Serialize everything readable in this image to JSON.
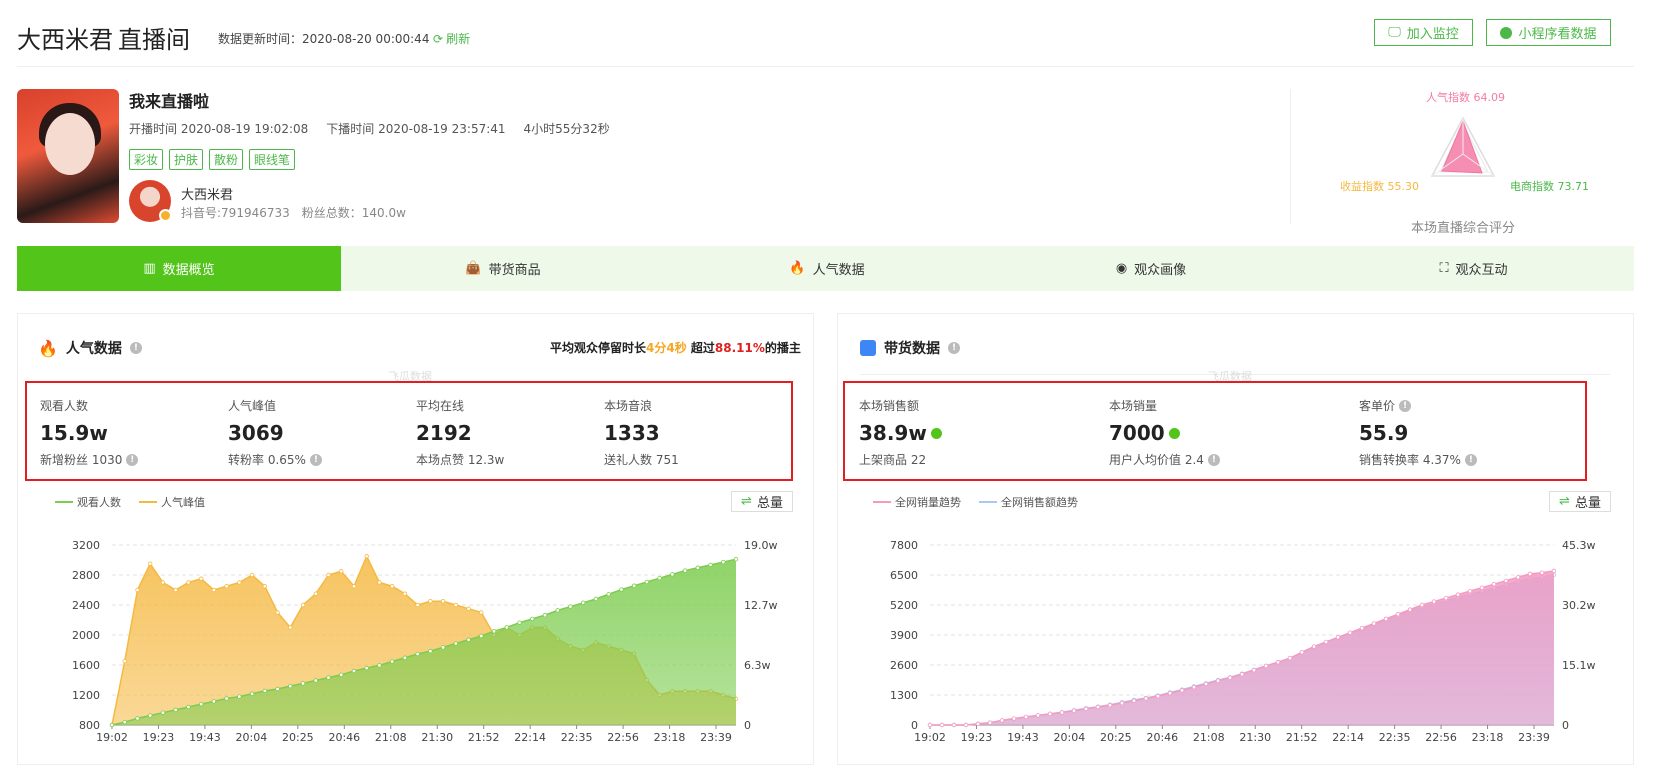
{
  "header": {
    "title": "大西米君",
    "subtitle": "直播间",
    "update_label": "数据更新时间：2020-08-20 00:00:44",
    "refresh_label": "刷新",
    "btn_monitor": "加入监控",
    "btn_mini": "小程序看数据"
  },
  "live": {
    "title": "我来直播啦",
    "start": "开播时间 2020-08-19 19:02:08",
    "end": "下播时间 2020-08-19 23:57:41",
    "duration": "4小时55分32秒",
    "tags": [
      "彩妆",
      "护肤",
      "散粉",
      "眼线笔"
    ],
    "anchor_name": "大西米君",
    "douyin_id": "抖音号:791946733",
    "fans": "粉丝总数：140.0w"
  },
  "score": {
    "popularity": "人气指数 64.09",
    "income": "收益指数 55.30",
    "ecommerce": "电商指数 73.71",
    "caption": "本场直播综合评分"
  },
  "tabs": [
    {
      "label": "数据概览",
      "icon": "bar-chart-icon"
    },
    {
      "label": "带货商品",
      "icon": "shopping-bag-icon"
    },
    {
      "label": "人气数据",
      "icon": "fire-icon"
    },
    {
      "label": "观众画像",
      "icon": "pulse-icon"
    },
    {
      "label": "观众互动",
      "icon": "focus-icon"
    }
  ],
  "popularity_panel": {
    "title": "人气数据",
    "stay_prefix": "平均观众停留时长",
    "stay_value": "4分4秒",
    "stay_mid": "超过",
    "stay_pct": "88.11%",
    "stay_suffix": "的播主",
    "watermark": "飞瓜数据",
    "metrics": [
      {
        "label": "观看人数",
        "value": "15.9w",
        "sub": "新增粉丝 1030"
      },
      {
        "label": "人气峰值",
        "value": "3069",
        "sub": "转粉率 0.65%"
      },
      {
        "label": "平均在线",
        "value": "2192",
        "sub": "本场点赞 12.3w"
      },
      {
        "label": "本场音浪",
        "value": "1333",
        "sub": "送礼人数 751"
      }
    ],
    "legend": [
      "观看人数",
      "人气峰值"
    ],
    "total_label": "总量"
  },
  "sales_panel": {
    "title": "带货数据",
    "watermark": "飞瓜数据",
    "metrics": [
      {
        "label": "本场销售额",
        "value": "38.9w",
        "sub": "上架商品 22"
      },
      {
        "label": "本场销量",
        "value": "7000",
        "sub": "用户人均价值 2.4"
      },
      {
        "label": "客单价",
        "value": "55.9",
        "sub": "销售转换率 4.37%"
      }
    ],
    "legend": [
      "全网销量趋势",
      "全网销售额趋势"
    ],
    "total_label": "总量"
  },
  "chart_data": [
    {
      "type": "area",
      "x": [
        "19:02",
        "19:23",
        "19:43",
        "20:04",
        "20:25",
        "20:46",
        "21:08",
        "21:30",
        "21:52",
        "22:14",
        "22:35",
        "22:56",
        "23:18",
        "23:39"
      ],
      "ylim_left": [
        800,
        3200
      ],
      "yticks_left": [
        "800",
        "1200",
        "1600",
        "2000",
        "2400",
        "2800",
        "3200"
      ],
      "yticks_right": [
        "0",
        "6.3w",
        "12.7w",
        "19.0w"
      ],
      "series": [
        {
          "name": "人气峰值",
          "axis": "left",
          "color": "#f5b942",
          "values": [
            800,
            1650,
            2600,
            2950,
            2700,
            2600,
            2700,
            2750,
            2600,
            2650,
            2700,
            2800,
            2650,
            2300,
            2100,
            2400,
            2550,
            2800,
            2850,
            2650,
            3050,
            2700,
            2650,
            2550,
            2400,
            2450,
            2450,
            2400,
            2350,
            2300,
            2000,
            2100,
            2000,
            2100,
            2100,
            1950,
            1850,
            1800,
            1900,
            1850,
            1800,
            1750,
            1400,
            1200,
            1250,
            1250,
            1250,
            1250,
            1200,
            1150
          ]
        },
        {
          "name": "观看人数",
          "axis": "right",
          "color": "#7ccc4e",
          "values": [
            0,
            0.3,
            0.7,
            1.0,
            1.3,
            1.6,
            1.9,
            2.2,
            2.5,
            2.8,
            3.0,
            3.3,
            3.6,
            3.8,
            4.1,
            4.4,
            4.7,
            5.0,
            5.3,
            5.7,
            6.0,
            6.3,
            6.7,
            7.1,
            7.5,
            7.8,
            8.2,
            8.6,
            9.0,
            9.4,
            9.9,
            10.3,
            10.8,
            11.2,
            11.6,
            12.1,
            12.5,
            12.9,
            13.3,
            13.8,
            14.3,
            14.7,
            15.1,
            15.5,
            15.9,
            16.3,
            16.6,
            16.9,
            17.2,
            17.5
          ]
        }
      ]
    },
    {
      "type": "area",
      "x": [
        "19:02",
        "19:23",
        "19:43",
        "20:04",
        "20:25",
        "20:46",
        "21:08",
        "21:30",
        "21:52",
        "22:14",
        "22:35",
        "22:56",
        "23:18",
        "23:39"
      ],
      "ylim_left": [
        0,
        7800
      ],
      "yticks_left": [
        "0",
        "1300",
        "2600",
        "3900",
        "5200",
        "6500",
        "7800"
      ],
      "yticks_right": [
        "0",
        "15.1w",
        "30.2w",
        "45.3w"
      ],
      "series": [
        {
          "name": "全网销量趋势",
          "axis": "left",
          "color": "#f49ac1",
          "values": [
            0,
            0,
            0,
            0,
            50,
            100,
            200,
            280,
            350,
            420,
            480,
            540,
            620,
            700,
            780,
            860,
            950,
            1050,
            1150,
            1250,
            1380,
            1500,
            1640,
            1780,
            1920,
            2050,
            2200,
            2380,
            2560,
            2720,
            2900,
            3150,
            3400,
            3600,
            3800,
            4000,
            4200,
            4400,
            4600,
            4800,
            5000,
            5200,
            5350,
            5500,
            5650,
            5800,
            5950,
            6100,
            6250,
            6400,
            6550,
            6600,
            6680
          ]
        },
        {
          "name": "全网销售额趋势",
          "axis": "right",
          "color": "#a8c8f5",
          "values": [
            0,
            0,
            0,
            0,
            0.3,
            0.6,
            1.1,
            1.6,
            2.0,
            2.4,
            2.8,
            3.2,
            3.7,
            4.2,
            4.6,
            5.1,
            5.7,
            6.3,
            6.8,
            7.4,
            8.2,
            8.9,
            9.7,
            10.5,
            11.3,
            12.0,
            12.9,
            13.9,
            14.9,
            15.8,
            16.8,
            18.3,
            19.7,
            20.8,
            22.0,
            23.1,
            24.2,
            25.3,
            26.4,
            27.5,
            28.6,
            29.7,
            30.5,
            31.3,
            32.1,
            32.9,
            33.7,
            34.5,
            35.3,
            36.1,
            36.9,
            37.2,
            37.8
          ]
        }
      ]
    }
  ]
}
